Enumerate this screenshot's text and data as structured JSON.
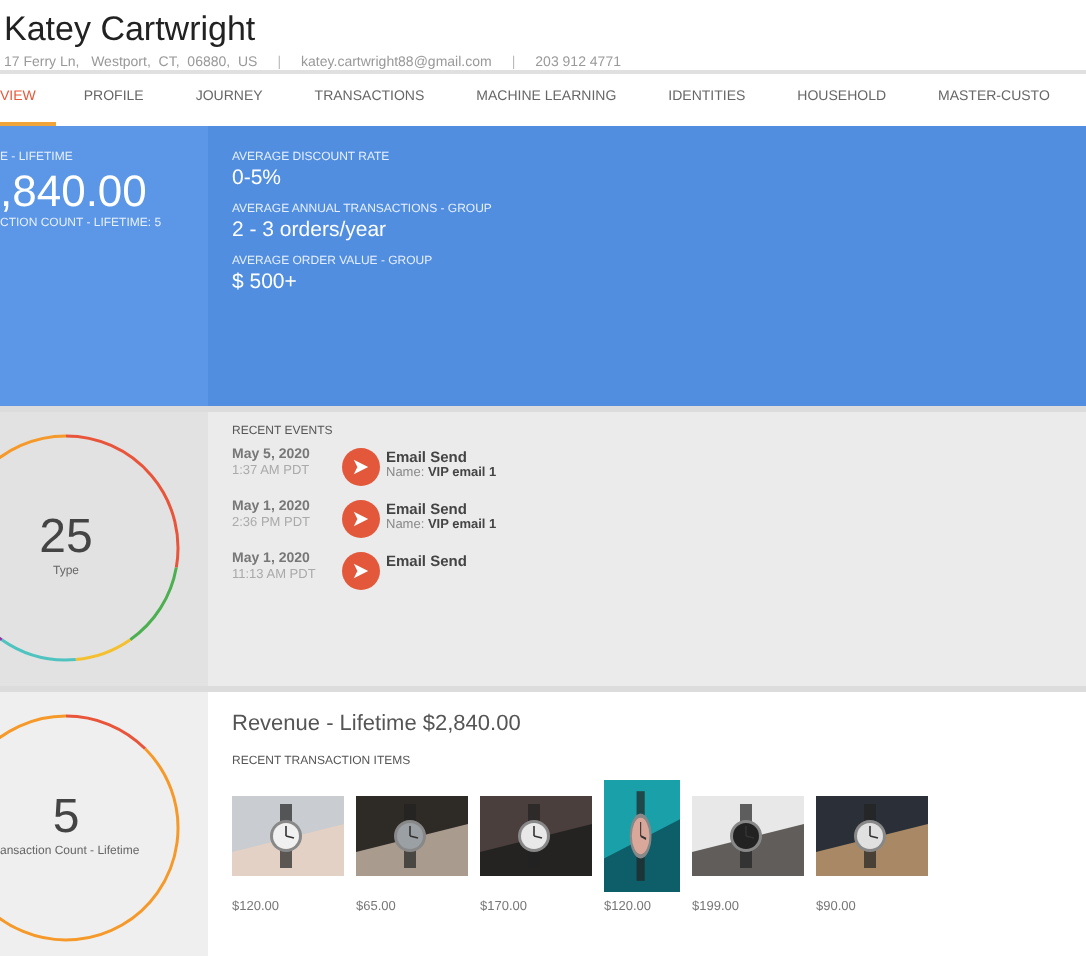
{
  "header": {
    "name": "Katey Cartwright",
    "address": "17 Ferry Ln,   Westport,  CT,  06880,  US",
    "separator": "|",
    "email": "katey.cartwright88@gmail.com",
    "separator_2": "|",
    "phone": "203 912 4771"
  },
  "tabs": [
    {
      "label": "VIEW",
      "selected": true
    },
    {
      "label": "PROFILE",
      "selected": false
    },
    {
      "label": "JOURNEY",
      "selected": false
    },
    {
      "label": "TRANSACTIONS",
      "selected": false
    },
    {
      "label": "MACHINE LEARNING",
      "selected": false
    },
    {
      "label": "IDENTITIES",
      "selected": false
    },
    {
      "label": "HOUSEHOLD",
      "selected": false
    },
    {
      "label": "MASTER-CUSTO",
      "selected": false
    }
  ],
  "summary": {
    "label": "E - LIFETIME",
    "value": ",840.00",
    "count": "CTION COUNT - LIFETIME: 5"
  },
  "stats": [
    {
      "label": "AVERAGE DISCOUNT RATE",
      "value": "0-5%"
    },
    {
      "label": "AVERAGE ANNUAL TRANSACTIONS - GROUP",
      "value": "2 - 3 orders/year"
    },
    {
      "label": "AVERAGE ORDER VALUE - GROUP",
      "value": "$ 500+"
    }
  ],
  "events_ring": {
    "value": "25",
    "label": "Type"
  },
  "recent_events": {
    "title": "RECENT EVENTS",
    "items": [
      {
        "date": "May 5, 2020",
        "time": "1:37 AM PDT",
        "event": "Email Send",
        "name_label": "Name:",
        "name": "VIP email 1"
      },
      {
        "date": "May 1, 2020",
        "time": "2:36 PM PDT",
        "event": "Email Send",
        "name_label": "Name:",
        "name": "VIP email 1"
      },
      {
        "date": "May 1, 2020",
        "time": "11:13 AM PDT",
        "event": "Email Send"
      }
    ]
  },
  "count_ring": {
    "value": "5",
    "label": "ansaction Count - Lifetime"
  },
  "revenue": {
    "title": "Revenue - Lifetime $2,840.00",
    "subtitle": "RECENT TRANSACTION ITEMS",
    "items": [
      {
        "price": "$120.00",
        "tall": false
      },
      {
        "price": "$65.00",
        "tall": false
      },
      {
        "price": "$170.00",
        "tall": false
      },
      {
        "price": "$120.00",
        "tall": true
      },
      {
        "price": "$199.00",
        "tall": false
      },
      {
        "price": "$90.00",
        "tall": false
      }
    ]
  }
}
